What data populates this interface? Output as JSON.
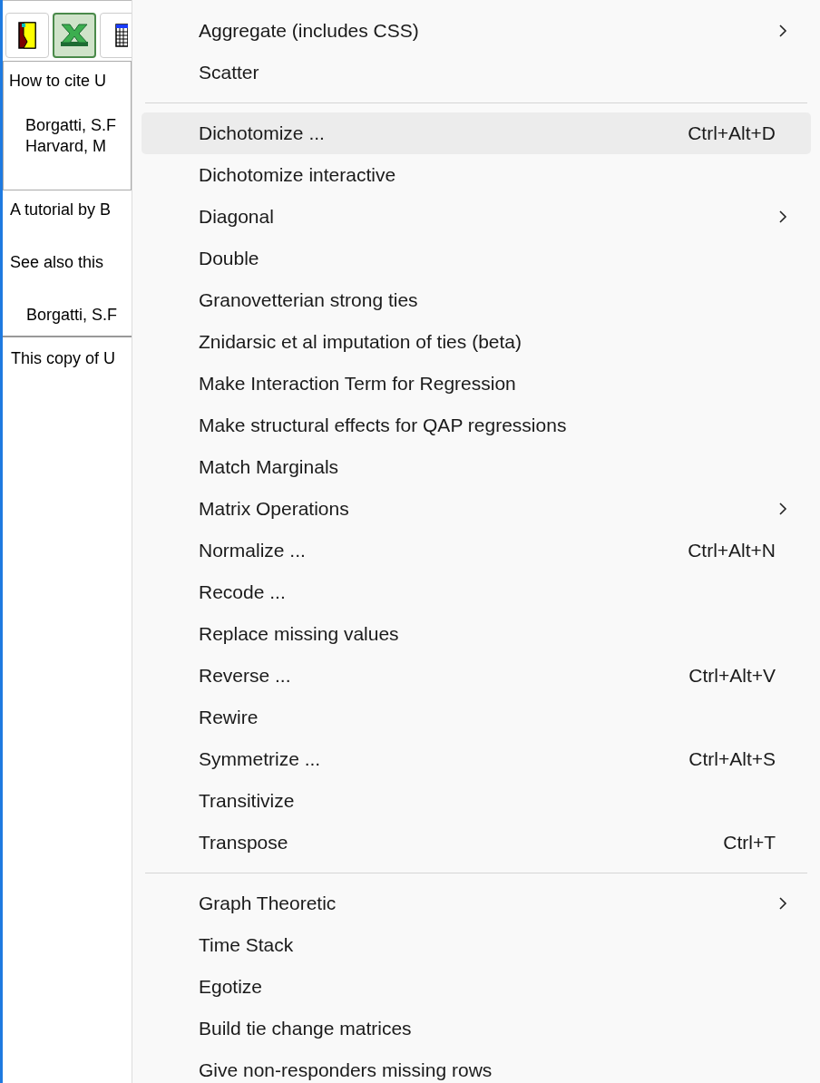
{
  "toolbar": {
    "buttons": [
      {
        "kind": "door",
        "selected": false
      },
      {
        "kind": "spreadsheet",
        "selected": true
      },
      {
        "kind": "grid",
        "selected": false
      }
    ]
  },
  "citation_box": {
    "heading": "How to cite U",
    "lines": [
      "Borgatti, S.F",
      "Harvard, M"
    ]
  },
  "info": {
    "tutorial": "A tutorial by B",
    "see_also": "See also this",
    "reference": "Borgatti, S.F"
  },
  "footer": "This copy of U",
  "menu": {
    "groups": [
      [
        {
          "label": "Aggregate (includes CSS)",
          "submenu": true,
          "selected": false
        },
        {
          "label": "Scatter",
          "submenu": false,
          "selected": false
        }
      ],
      [
        {
          "label": "Dichotomize ...",
          "shortcut": "Ctrl+Alt+D",
          "submenu": false,
          "selected": true
        },
        {
          "label": "Dichotomize interactive",
          "submenu": false,
          "selected": false
        },
        {
          "label": "Diagonal",
          "submenu": true,
          "selected": false
        },
        {
          "label": "Double",
          "submenu": false,
          "selected": false
        },
        {
          "label": "Granovetterian strong ties",
          "submenu": false,
          "selected": false
        },
        {
          "label": "Znidarsic et al imputation of ties (beta)",
          "submenu": false,
          "selected": false
        },
        {
          "label": "Make Interaction Term for Regression",
          "submenu": false,
          "selected": false
        },
        {
          "label": "Make structural effects for QAP regressions",
          "submenu": false,
          "selected": false
        },
        {
          "label": "Match Marginals",
          "submenu": false,
          "selected": false
        },
        {
          "label": "Matrix Operations",
          "submenu": true,
          "selected": false
        },
        {
          "label": "Normalize ...",
          "shortcut": "Ctrl+Alt+N",
          "submenu": false,
          "selected": false
        },
        {
          "label": "Recode ...",
          "submenu": false,
          "selected": false
        },
        {
          "label": "Replace missing values",
          "submenu": false,
          "selected": false
        },
        {
          "label": "Reverse ...",
          "shortcut": "Ctrl+Alt+V",
          "submenu": false,
          "selected": false
        },
        {
          "label": "Rewire",
          "submenu": false,
          "selected": false
        },
        {
          "label": "Symmetrize ...",
          "shortcut": "Ctrl+Alt+S",
          "submenu": false,
          "selected": false
        },
        {
          "label": "Transitivize",
          "submenu": false,
          "selected": false
        },
        {
          "label": "Transpose",
          "shortcut": "Ctrl+T",
          "submenu": false,
          "selected": false
        }
      ],
      [
        {
          "label": "Graph Theoretic",
          "submenu": true,
          "selected": false
        },
        {
          "label": "Time Stack",
          "submenu": false,
          "selected": false
        },
        {
          "label": "Egotize",
          "submenu": false,
          "selected": false
        },
        {
          "label": "Build tie change matrices",
          "submenu": false,
          "selected": false
        },
        {
          "label": "Give non-responders missing rows",
          "submenu": false,
          "selected": false
        }
      ]
    ]
  }
}
